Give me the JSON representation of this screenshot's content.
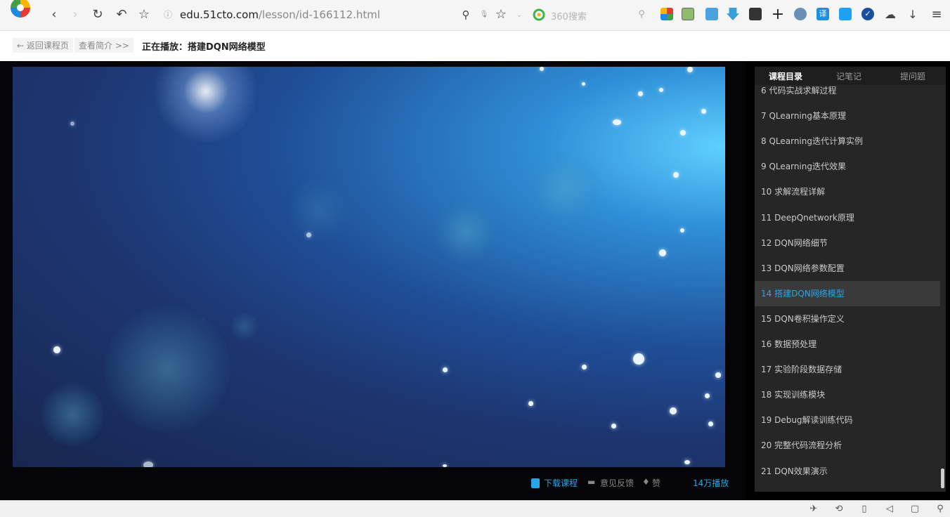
{
  "browser": {
    "url_domain": "edu.51cto.com",
    "url_path": "/lesson/id-166112.html",
    "search_placeholder": "360搜索",
    "icons": [
      "back-icon",
      "forward-icon",
      "reload-icon",
      "undo-icon",
      "star-icon",
      "search-icon",
      "bookmark-icon",
      "menu-icon"
    ]
  },
  "header": {
    "back_label": "← 返回课程页",
    "intro_label": "查看简介 >>",
    "now_playing": "正在播放：搭建DQN网络模型"
  },
  "player": {
    "download_label": "下载课程",
    "feedback_label": "意见反馈",
    "like_label": "赞",
    "viewers_label": "14万播放"
  },
  "sidebar": {
    "tabs": [
      {
        "label": "课程目录",
        "active": true
      },
      {
        "label": "记笔记",
        "active": false
      },
      {
        "label": "提问题",
        "active": false
      }
    ],
    "items": [
      {
        "label": "6 代码实战求解过程",
        "dur": "",
        "active": false
      },
      {
        "label": "7 QLearning基本原理",
        "dur": "",
        "active": false
      },
      {
        "label": "8 QLearning迭代计算实例",
        "dur": "",
        "active": false
      },
      {
        "label": "9 QLearning迭代效果",
        "dur": "",
        "active": false
      },
      {
        "label": "10 求解流程详解",
        "dur": "",
        "active": false
      },
      {
        "label": "11 DeepQnetwork原理",
        "dur": "",
        "active": false
      },
      {
        "label": "12 DQN网络细节",
        "dur": "",
        "active": false
      },
      {
        "label": "13 DQN网络参数配置",
        "dur": "",
        "active": false
      },
      {
        "label": "14 搭建DQN网络模型",
        "dur": "",
        "active": true
      },
      {
        "label": "15 DQN卷积操作定义",
        "dur": "",
        "active": false
      },
      {
        "label": "16 数据预处理",
        "dur": "",
        "active": false
      },
      {
        "label": "17 实验阶段数据存储",
        "dur": "",
        "active": false
      },
      {
        "label": "18 实现训练模块",
        "dur": "",
        "active": false
      },
      {
        "label": "19 Debug解读训练代码",
        "dur": "",
        "active": false
      },
      {
        "label": "20 完整代码流程分析",
        "dur": "",
        "active": false
      },
      {
        "label": "21 DQN效果演示",
        "dur": "",
        "active": false
      }
    ]
  },
  "colors": {
    "accent": "#2aa6e8",
    "sidebar_bg": "#262626",
    "video_light": "#5fd0ff",
    "video_dark": "#172650"
  }
}
